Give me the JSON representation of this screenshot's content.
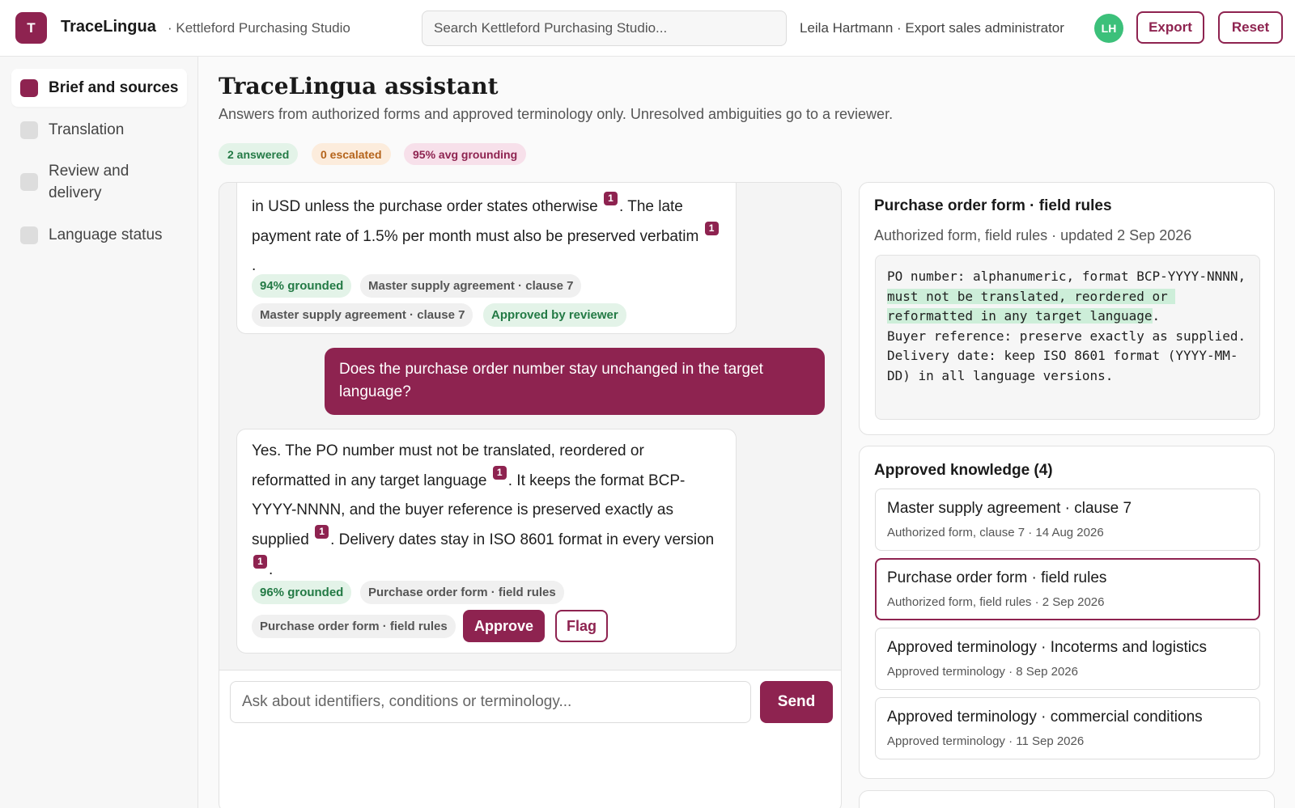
{
  "header": {
    "logo_letter": "T",
    "brand": "TraceLingua",
    "workspace": "· Kettleford Purchasing Studio",
    "search_placeholder": "Search Kettleford Purchasing Studio...",
    "user": "Leila Hartmann · Export sales administrator",
    "avatar_initials": "LH",
    "export_label": "Export",
    "reset_label": "Reset"
  },
  "sidebar": {
    "items": [
      {
        "label": "Brief and sources",
        "active": true
      },
      {
        "label": "Translation",
        "active": false
      },
      {
        "label": "Review and delivery",
        "active": false
      },
      {
        "label": "Language status",
        "active": false
      }
    ]
  },
  "main": {
    "title": "TraceLingua assistant",
    "subtitle": "Answers from authorized forms and approved terminology only. Unresolved ambiguities go to a reviewer.",
    "stats": {
      "answered": "2 answered",
      "escalated": "0 escalated",
      "grounding": "95% avg grounding"
    }
  },
  "chat": {
    "msg1": {
      "seg1": "in USD unless the purchase order states otherwise",
      "seg2": ". The late payment rate of 1.5% per month must also be preserved verbatim",
      "seg3": ".",
      "citation": "1",
      "grounded": "94% grounded",
      "source1": "Master supply agreement · clause 7",
      "source2": "Master supply agreement · clause 7",
      "status": "Approved by reviewer"
    },
    "user_msg": "Does the purchase order number stay unchanged in the target language?",
    "msg2": {
      "seg1": "Yes. The PO number must not be translated, reordered or reformatted in any target language",
      "seg2": ". It keeps the format BCP-YYYY-NNNN, and the buyer reference is preserved exactly as supplied",
      "seg3": ". Delivery dates stay in ISO 8601 format in every version",
      "seg4": ".",
      "citation": "1",
      "grounded": "96% grounded",
      "source1": "Purchase order form · field rules",
      "source2": "Purchase order form · field rules",
      "approve_label": "Approve",
      "flag_label": "Flag"
    },
    "composer_placeholder": "Ask about identifiers, conditions or terminology...",
    "send_label": "Send"
  },
  "form_card": {
    "title": "Purchase order form · field rules",
    "meta": "Authorized form, field rules · updated 2 Sep 2026",
    "code_pre": "PO number: alphanumeric, format BCP-YYYY-NNNN, ",
    "code_highlight": "must not be translated, reordered or reformatted in any target language",
    "code_post": ".\nBuyer reference: preserve exactly as supplied.\nDelivery date: keep ISO 8601 format (YYYY-MM-DD) in all language versions."
  },
  "knowledge": {
    "title": "Approved knowledge (4)",
    "items": [
      {
        "title": "Master supply agreement · clause 7",
        "meta": "Authorized form, clause 7 · 14 Aug 2026",
        "selected": false
      },
      {
        "title": "Purchase order form · field rules",
        "meta": "Authorized form, field rules · 2 Sep 2026",
        "selected": true
      },
      {
        "title": "Approved terminology · Incoterms and logistics",
        "meta": "Approved terminology · 8 Sep 2026",
        "selected": false
      },
      {
        "title": "Approved terminology · commercial conditions",
        "meta": "Approved terminology · 11 Sep 2026",
        "selected": false
      }
    ]
  },
  "colors": {
    "accent": "#8e2350",
    "success": "#237a45",
    "warning": "#b5641b",
    "avatar": "#3cc07a"
  }
}
